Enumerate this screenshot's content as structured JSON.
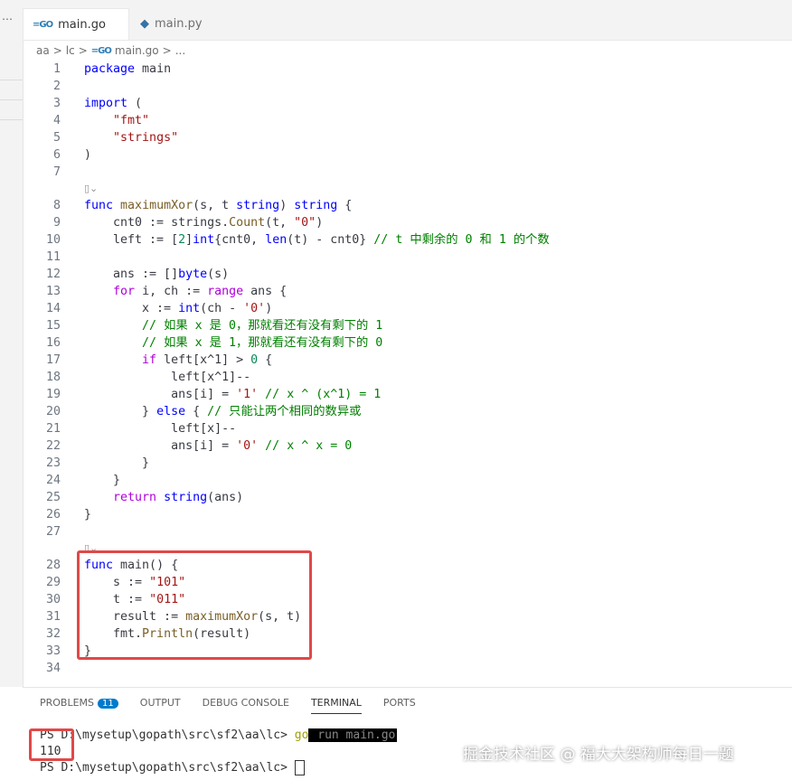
{
  "tabs": [
    {
      "label": "main.go",
      "active": true,
      "icon": "go-file-icon"
    },
    {
      "label": "main.py",
      "active": false,
      "icon": "python-file-icon"
    }
  ],
  "breadcrumb": [
    "aa",
    "lc",
    "main.go",
    "..."
  ],
  "code": {
    "line_numbers": [
      "1",
      "2",
      "3",
      "4",
      "5",
      "6",
      "7",
      "8",
      "9",
      "10",
      "11",
      "12",
      "13",
      "14",
      "15",
      "16",
      "17",
      "18",
      "19",
      "20",
      "21",
      "22",
      "23",
      "24",
      "25",
      "26",
      "27",
      "28",
      "29",
      "30",
      "31",
      "32",
      "33",
      "34"
    ],
    "lines": [
      "package main",
      "",
      "import (",
      "    \"fmt\"",
      "    \"strings\"",
      ")",
      "",
      "func maximumXor(s, t string) string {",
      "    cnt0 := strings.Count(t, \"0\")",
      "    left := [2]int{cnt0, len(t) - cnt0} // t 中剩余的 0 和 1 的个数",
      "",
      "    ans := []byte(s)",
      "    for i, ch := range ans {",
      "        x := int(ch - '0')",
      "        // 如果 x 是 0，那就看还有没有剩下的 1",
      "        // 如果 x 是 1，那就看还有没有剩下的 0",
      "        if left[x^1] > 0 {",
      "            left[x^1]--",
      "            ans[i] = '1' // x ^ (x^1) = 1",
      "        } else { // 只能让两个相同的数异或",
      "            left[x]--",
      "            ans[i] = '0' // x ^ x = 0",
      "        }",
      "    }",
      "    return string(ans)",
      "}",
      "",
      "func main() {",
      "    s := \"101\"",
      "    t := \"011\"",
      "    result := maximumXor(s, t)",
      "    fmt.Println(result)",
      "}",
      ""
    ]
  },
  "panel": {
    "tabs": [
      {
        "label": "PROBLEMS",
        "badge": "11"
      },
      {
        "label": "OUTPUT"
      },
      {
        "label": "DEBUG CONSOLE"
      },
      {
        "label": "TERMINAL",
        "active": true
      },
      {
        "label": "PORTS"
      }
    ],
    "terminal": {
      "prompt1": "PS D:\\mysetup\\gopath\\src\\sf2\\aa\\lc> ",
      "cmd_go": "go",
      "cmd_rest": " run main.go",
      "output": "110",
      "prompt2": "PS D:\\mysetup\\gopath\\src\\sf2\\aa\\lc> "
    }
  },
  "watermark": "掘金技术社区 @ 福大大架构师每日一题"
}
